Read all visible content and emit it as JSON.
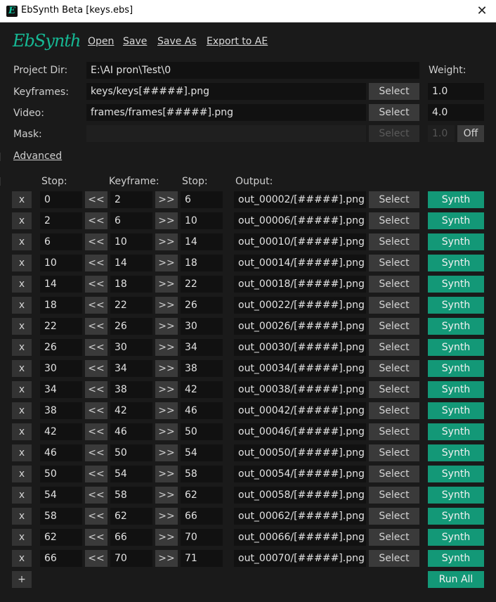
{
  "window": {
    "title": "EbSynth Beta [keys.ebs]",
    "close_glyph": "✕",
    "icon_glyph": "E"
  },
  "logo": "EbSynth",
  "menu": {
    "open": "Open",
    "save": "Save",
    "save_as": "Save As",
    "export": "Export to AE"
  },
  "project": {
    "project_dir_label": "Project Dir:",
    "project_dir_value": "E:\\AI pron\\Test\\0",
    "weight_label": "Weight:",
    "keyframes_label": "Keyframes:",
    "keyframes_value": "keys/keys[#####].png",
    "keyframes_weight": "1.0",
    "video_label": "Video:",
    "video_value": "frames/frames[#####].png",
    "video_weight": "4.0",
    "mask_label": "Mask:",
    "mask_value": "",
    "mask_weight": "1.0",
    "mask_toggle": "Off",
    "select_label": "Select"
  },
  "advanced_label": "Advanced",
  "headers": {
    "stop1": "Stop:",
    "keyframe": "Keyframe:",
    "stop2": "Stop:",
    "output": "Output:"
  },
  "row_buttons": {
    "remove": "x",
    "prev": "<<",
    "next": ">>",
    "select": "Select",
    "synth": "Synth"
  },
  "rows": [
    {
      "stop1": "0",
      "key": "2",
      "stop2": "6",
      "output": "out_00002/[#####].png"
    },
    {
      "stop1": "2",
      "key": "6",
      "stop2": "10",
      "output": "out_00006/[#####].png"
    },
    {
      "stop1": "6",
      "key": "10",
      "stop2": "14",
      "output": "out_00010/[#####].png"
    },
    {
      "stop1": "10",
      "key": "14",
      "stop2": "18",
      "output": "out_00014/[#####].png"
    },
    {
      "stop1": "14",
      "key": "18",
      "stop2": "22",
      "output": "out_00018/[#####].png"
    },
    {
      "stop1": "18",
      "key": "22",
      "stop2": "26",
      "output": "out_00022/[#####].png"
    },
    {
      "stop1": "22",
      "key": "26",
      "stop2": "30",
      "output": "out_00026/[#####].png"
    },
    {
      "stop1": "26",
      "key": "30",
      "stop2": "34",
      "output": "out_00030/[#####].png"
    },
    {
      "stop1": "30",
      "key": "34",
      "stop2": "38",
      "output": "out_00034/[#####].png"
    },
    {
      "stop1": "34",
      "key": "38",
      "stop2": "42",
      "output": "out_00038/[#####].png"
    },
    {
      "stop1": "38",
      "key": "42",
      "stop2": "46",
      "output": "out_00042/[#####].png"
    },
    {
      "stop1": "42",
      "key": "46",
      "stop2": "50",
      "output": "out_00046/[#####].png"
    },
    {
      "stop1": "46",
      "key": "50",
      "stop2": "54",
      "output": "out_00050/[#####].png"
    },
    {
      "stop1": "50",
      "key": "54",
      "stop2": "58",
      "output": "out_00054/[#####].png"
    },
    {
      "stop1": "54",
      "key": "58",
      "stop2": "62",
      "output": "out_00058/[#####].png"
    },
    {
      "stop1": "58",
      "key": "62",
      "stop2": "66",
      "output": "out_00062/[#####].png"
    },
    {
      "stop1": "62",
      "key": "66",
      "stop2": "70",
      "output": "out_00066/[#####].png"
    },
    {
      "stop1": "66",
      "key": "70",
      "stop2": "71",
      "output": "out_00070/[#####].png"
    }
  ],
  "footer": {
    "add": "+",
    "run_all": "Run All"
  },
  "colors": {
    "accent": "#139877",
    "background": "#1a1a1a",
    "field": "#111111",
    "button": "#3a3a3a"
  }
}
